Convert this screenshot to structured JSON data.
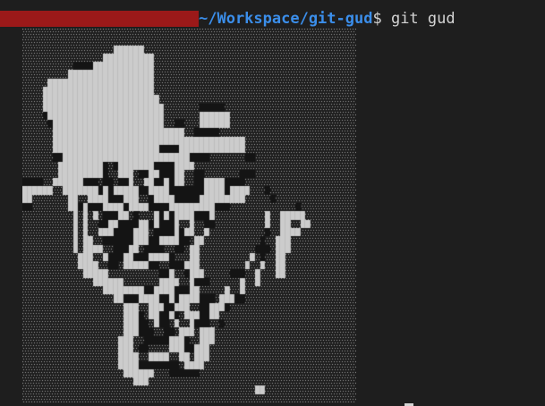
{
  "terminal": {
    "prompt": {
      "user_host": "",
      "path": "~/Workspace/git-gud",
      "symbol": "$ ",
      "command": "git gud"
    }
  },
  "output": {
    "art": {
      "description_type": "ascii-art",
      "colors": {
        "background": "#1e1e1e",
        "dots": "#a8a8a8",
        "solid": "#cccccc",
        "dark": "#141414"
      },
      "rows": [
        "................................................................",
        "................................................................",
        "..................######.........................................",
        "................##########.......................................",
        "..........XXXX############.......................................",
        ".........#################.......................................",
        ".....#####################.......................................",
        "....######################.......................................",
        "....#######################......................................",
        "....########################.......XXXXX........................",
        "....X#######################.......######........................",
        ".....X######################..XX...######........................",
        "......##########################..XXXXX..........................",
        "......######################################.....................",
        "......#####################XXXX#############.....................",
        "......XX#########################XXXX.......XX...................",
        ".......#########X.X#######XXXX####...............................",
        ".......#########X..###.XX##XXX##..XX.......XXX....................",
        "XXXX..######XXX.XX.XX#..##XX#X##..XX####XXXX...................",
        "######..#######X#X#####XX####XXXXXXX####X####...X................",
        "##.......##..####XXX###..X####XXXXX#########.....X...............",
        "XX.......##X#XXX####X####XXXX#########XXX.............X..........",
        "..........#.#.#.XXX##.X...#X#X####XXX#..........#..#####.........",
        "..........#.#..XX##XXXX##X#XXX#..#..XX..........#..##..##........",
        "..........#.#..###XXXX###.XXXX#X##..#...........X..####..........",
        "..........#.##..XXXXXX###XX####XX.##...........X..###............",
        "..........#.####..XXX##.XXXX..XX.##...........XXX.###............",
        "...........###..#XXX##XXX####X...##..........#.X..##.............",
        "...........####..XX.#####XX..XXX###.........#..#..##.............",
        "............#####..........XX#..X###.....XXX..#...##.............",
        "..............######.......####..#XXX......#..#..................",
        "................########XX####XXX##.....#..#.....................",
        "..................##XXX####XX#X####XXX.###XX.....................",
        "....................###..###XX###..XX###X........................",
        "....................###X.##XX#X.###XX##..........................",
        "....................###XX.#XX.#..#XXX..X.........................",
        "....................###XXX..XX.###.###...........................",
        "...................###..XXXXX###X..###...........................",
        "...................###.XX....###XX###...........................",
        "...................####..####..##.###...........................",
        "...................####XXXXXXXX.####.............................",
        "....................######...XXXXXX..............................",
        "......................###........................................",
        "..............................................##.................",
        "................................................................"
      ]
    }
  }
}
